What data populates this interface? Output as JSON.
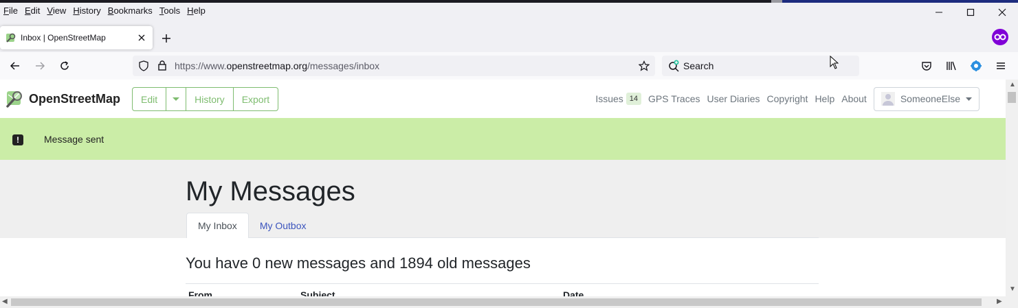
{
  "menubar": {
    "items": [
      {
        "label": "File",
        "accel": "F",
        "rest": "ile"
      },
      {
        "label": "Edit",
        "accel": "E",
        "rest": "dit"
      },
      {
        "label": "View",
        "accel": "V",
        "rest": "iew"
      },
      {
        "label": "History",
        "accel": "H",
        "rest": "istory"
      },
      {
        "label": "Bookmarks",
        "accel": "B",
        "rest": "ookmarks"
      },
      {
        "label": "Tools",
        "accel": "T",
        "rest": "ools"
      },
      {
        "label": "Help",
        "accel": "H",
        "rest": "elp"
      }
    ]
  },
  "tab": {
    "title": "Inbox | OpenStreetMap"
  },
  "urlbar": {
    "prefix": "https://www.",
    "host": "openstreetmap.org",
    "path": "/messages/inbox"
  },
  "search": {
    "placeholder": "Search"
  },
  "osm": {
    "brand": "OpenStreetMap",
    "buttons": {
      "edit": "Edit",
      "history": "History",
      "export": "Export"
    },
    "nav": {
      "issues": "Issues",
      "issues_count": "14",
      "gps": "GPS Traces",
      "diaries": "User Diaries",
      "copyright": "Copyright",
      "help": "Help",
      "about": "About"
    },
    "user": "SomeoneElse"
  },
  "flash": {
    "text": "Message sent"
  },
  "content": {
    "title": "My Messages",
    "tabs": {
      "inbox": "My Inbox",
      "outbox": "My Outbox"
    },
    "summary": "You have 0 new messages and 1894 old messages",
    "columns": {
      "from": "From",
      "subject": "Subject",
      "date": "Date"
    }
  },
  "colors": {
    "accent": "#7ebc6f",
    "flash_bg": "#cbeda7",
    "link": "#3a53bd",
    "private": "#8000d7"
  }
}
